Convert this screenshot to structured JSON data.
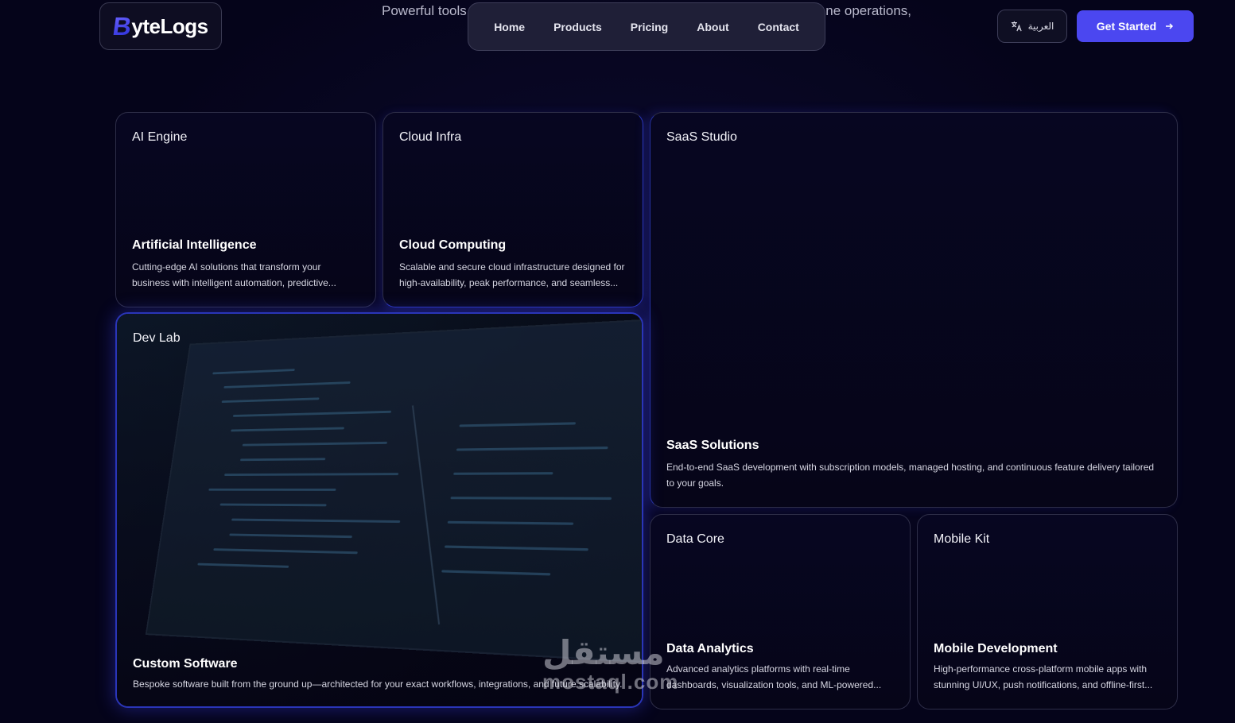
{
  "header": {
    "tagline_left": "Powerful tools",
    "tagline_right": "ne operations,",
    "logo_text": "yteLogs",
    "logo_initial": "B",
    "nav": [
      "Home",
      "Products",
      "Pricing",
      "About",
      "Contact"
    ],
    "language_label": "العربية",
    "cta_label": "Get Started"
  },
  "cards": [
    {
      "tag": "AI Engine",
      "title": "Artificial Intelligence",
      "desc": "Cutting-edge AI solutions that transform your business with intelligent automation, predictive..."
    },
    {
      "tag": "Cloud Infra",
      "title": "Cloud Computing",
      "desc": "Scalable and secure cloud infrastructure designed for high-availability, peak performance, and seamless..."
    },
    {
      "tag": "SaaS Studio",
      "title": "SaaS Solutions",
      "desc": "End-to-end SaaS development with subscription models, managed hosting, and continuous feature delivery tailored to your goals."
    },
    {
      "tag": "Dev Lab",
      "title": "Custom Software",
      "desc": "Bespoke software built from the ground up—architected for your exact workflows, integrations, and future scalability."
    },
    {
      "tag": "Data Core",
      "title": "Data Analytics",
      "desc": "Advanced analytics platforms with real-time dashboards, visualization tools, and ML-powered..."
    },
    {
      "tag": "Mobile Kit",
      "title": "Mobile Development",
      "desc": "High-performance cross-platform mobile apps with stunning UI/UX, push notifications, and offline-first..."
    }
  ],
  "watermark": {
    "arabic": "مستقل",
    "latin": "mostaql.com"
  }
}
